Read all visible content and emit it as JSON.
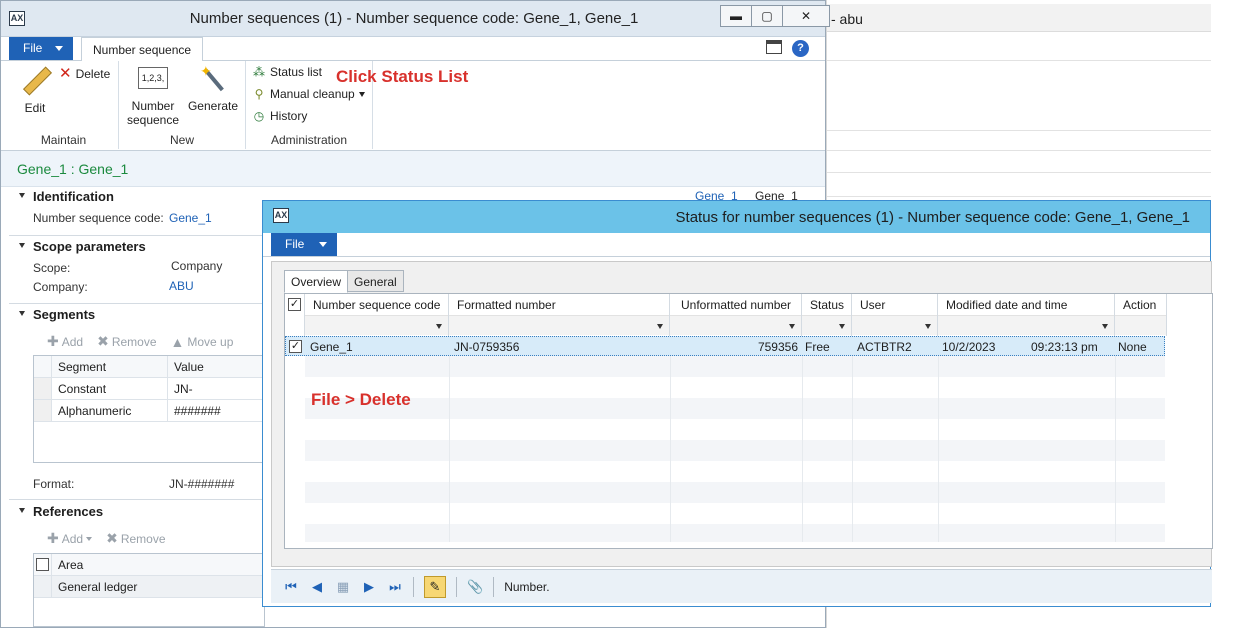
{
  "background_window": {
    "title_suffix": "- abu"
  },
  "main_window": {
    "app_icon": "AX",
    "title": "Number sequences (1) - Number sequence code: Gene_1, Gene_1",
    "controls": {
      "minimize": "▬",
      "maximize": "▢",
      "close": "✕"
    },
    "file_label": "File",
    "ribbon_tab": "Number sequence",
    "ribbon": {
      "maintain": {
        "label": "Maintain",
        "edit": "Edit",
        "delete": "Delete"
      },
      "new": {
        "label": "New",
        "number_sequence_line1": "Number",
        "number_sequence_line2": "sequence",
        "generate": "Generate",
        "icon_text": "1,2,3,"
      },
      "administration": {
        "label": "Administration",
        "status_list": "Status list",
        "manual_cleanup": "Manual cleanup",
        "history": "History"
      }
    },
    "annotation_status": "Click Status List",
    "breadcrumb": "Gene_1 : Gene_1",
    "clipped_header": {
      "a": "Gene_1",
      "b": "Gene_1"
    },
    "identification": {
      "header": "Identification",
      "code_label": "Number sequence code:",
      "code_value": "Gene_1"
    },
    "scope": {
      "header": "Scope parameters",
      "scope_label": "Scope:",
      "scope_value": "Company",
      "company_label": "Company:",
      "company_value": "ABU"
    },
    "segments": {
      "header": "Segments",
      "toolbar": {
        "add": "Add",
        "remove": "Remove",
        "move_up": "Move up"
      },
      "columns": [
        "Segment",
        "Value"
      ],
      "rows": [
        {
          "segment": "Constant",
          "value": "JN-"
        },
        {
          "segment": "Alphanumeric",
          "value": "#######"
        }
      ],
      "format_label": "Format:",
      "format_value": "JN-#######"
    },
    "references": {
      "header": "References",
      "toolbar": {
        "add": "Add",
        "remove": "Remove"
      },
      "column": "Area",
      "rows": [
        "General ledger"
      ]
    }
  },
  "status_window": {
    "app_icon": "AX",
    "title": "Status for number sequences (1) - Number sequence code: Gene_1, Gene_1",
    "file_label": "File",
    "tabs": [
      "Overview",
      "General"
    ],
    "columns": [
      "Number sequence code",
      "Formatted number",
      "Unformatted number",
      "Status",
      "User",
      "Modified date and time",
      "Action"
    ],
    "rows": [
      {
        "code": "Gene_1",
        "formatted": "JN-0759356",
        "unformatted": "759356",
        "status": "Free",
        "user": "ACTBTR2",
        "date": "10/2/2023",
        "time": "09:23:13 pm",
        "action": "None"
      }
    ],
    "annotation_delete": "File > Delete",
    "footer": {
      "first": "⏮",
      "prev": "◀",
      "grid": "▦",
      "next": "▶",
      "last": "⏭",
      "edit": "✎",
      "attach": "📎",
      "status_text": "Number."
    }
  }
}
